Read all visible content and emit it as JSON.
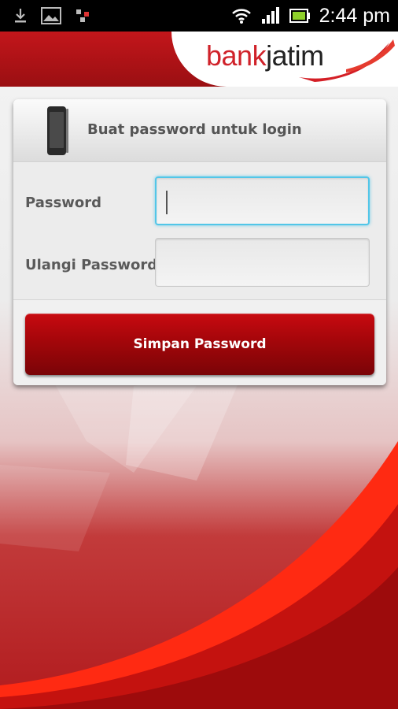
{
  "status_bar": {
    "time": "2:44 pm",
    "icons": [
      "download-icon",
      "image-icon",
      "notification-icon",
      "wifi-icon",
      "signal-icon",
      "battery-icon"
    ]
  },
  "header": {
    "logo_part1": "bank",
    "logo_part2": "jatim"
  },
  "card": {
    "title": "Buat password untuk login",
    "password_label": "Password",
    "password_value": "",
    "confirm_label": "Ulangi Password",
    "confirm_value": "",
    "save_label": "Simpan Password"
  },
  "colors": {
    "brand_red": "#c3161b",
    "focus_blue": "#52c6e8"
  }
}
